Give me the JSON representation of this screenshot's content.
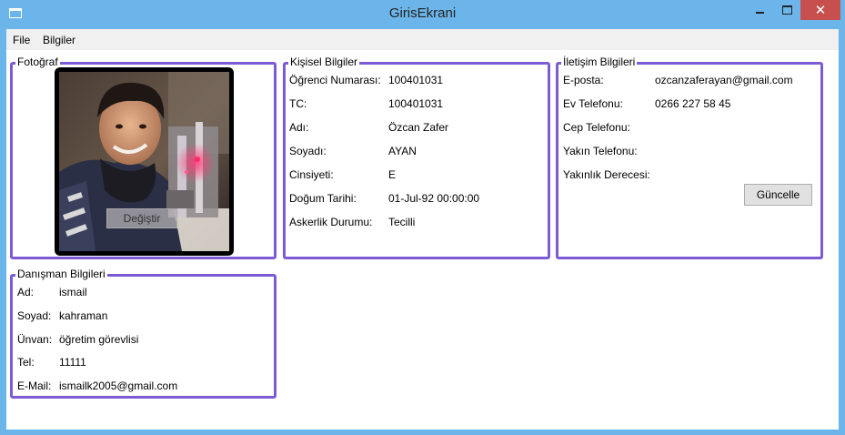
{
  "window": {
    "title": "GirisEkrani",
    "close_glyph": "✕",
    "app_icon": "window-icon",
    "minimize_icon": "minimize-icon",
    "maximize_icon": "maximize-icon"
  },
  "menu": {
    "file": "File",
    "info": "Bilgiler"
  },
  "photo": {
    "group_title": "Fotoğraf",
    "change_button": "Değiştir"
  },
  "personal": {
    "group_title": "Kişisel Bilgiler",
    "rows": [
      {
        "label": "Öğrenci Numarası:",
        "value": "100401031"
      },
      {
        "label": "TC:",
        "value": "100401031"
      },
      {
        "label": "Adı:",
        "value": "Özcan Zafer"
      },
      {
        "label": "Soyadı:",
        "value": "AYAN"
      },
      {
        "label": "Cinsiyeti:",
        "value": "E"
      },
      {
        "label": "Doğum Tarihi:",
        "value": "01-Jul-92 00:00:00"
      },
      {
        "label": "Askerlik Durumu:",
        "value": "Tecilli"
      }
    ]
  },
  "contact": {
    "group_title": "İletişim Bilgileri",
    "rows": [
      {
        "label": "E-posta:",
        "value": "ozcanzaferayan@gmail.com"
      },
      {
        "label": "Ev Telefonu:",
        "value": "0266 227 58 45"
      },
      {
        "label": "Cep Telefonu:",
        "value": ""
      },
      {
        "label": "Yakın Telefonu:",
        "value": ""
      },
      {
        "label": "Yakınlık Derecesi:",
        "value": ""
      }
    ],
    "update_button": "Güncelle"
  },
  "advisor": {
    "group_title": "Danışman Bilgileri",
    "rows": [
      {
        "label": "Ad:",
        "value": "ismail"
      },
      {
        "label": "Soyad:",
        "value": "kahraman"
      },
      {
        "label": "Ünvan:",
        "value": "öğretim görevlisi"
      },
      {
        "label": "Tel:",
        "value": "11111"
      },
      {
        "label": "E-Mail:",
        "value": "ismailk2005@gmail.com"
      }
    ]
  },
  "colors": {
    "titlebar": "#6cb5ea",
    "group_border": "#7b5cd6",
    "close_button": "#c7504f"
  }
}
